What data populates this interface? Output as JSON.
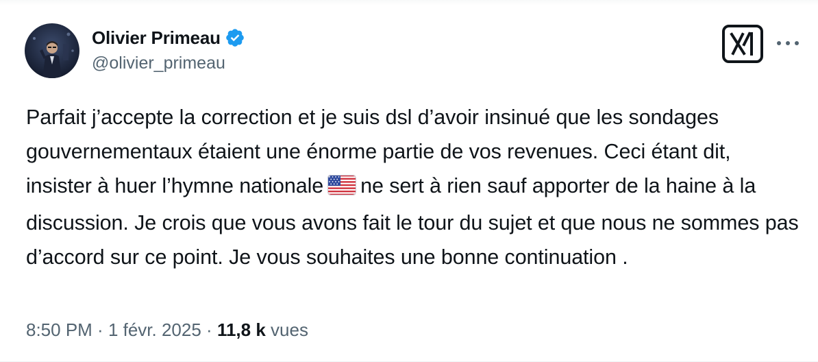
{
  "author": {
    "display_name": "Olivier Primeau",
    "handle": "@olivier_primeau",
    "verified": true
  },
  "tweet": {
    "text_before_flag": "Parfait j’accepte la correction et je suis dsl d’avoir insinué que les sondages gouvernementaux étaient une énorme partie de vos revenues. Ceci étant dit, insister à huer l’hymne nationale",
    "flag_icon": "us-flag-icon",
    "text_after_flag": "ne sert à rien sauf apporter de la haine à la discussion. Je crois que vous avons fait le tour du sujet et que nous ne sommes pas d’accord sur ce point. Je vous souhaites une bonne continuation ."
  },
  "meta": {
    "time": "8:50 PM",
    "separator": " · ",
    "date": "1 févr. 2025",
    "views_count": "11,8 k",
    "views_label": "vues"
  },
  "icons": {
    "verified": "verified-badge-icon",
    "logo": "x-logo-icon",
    "more": "more-options-icon"
  },
  "colors": {
    "text": "#0f1419",
    "secondary": "#536471",
    "verified_blue": "#1d9bf0"
  }
}
